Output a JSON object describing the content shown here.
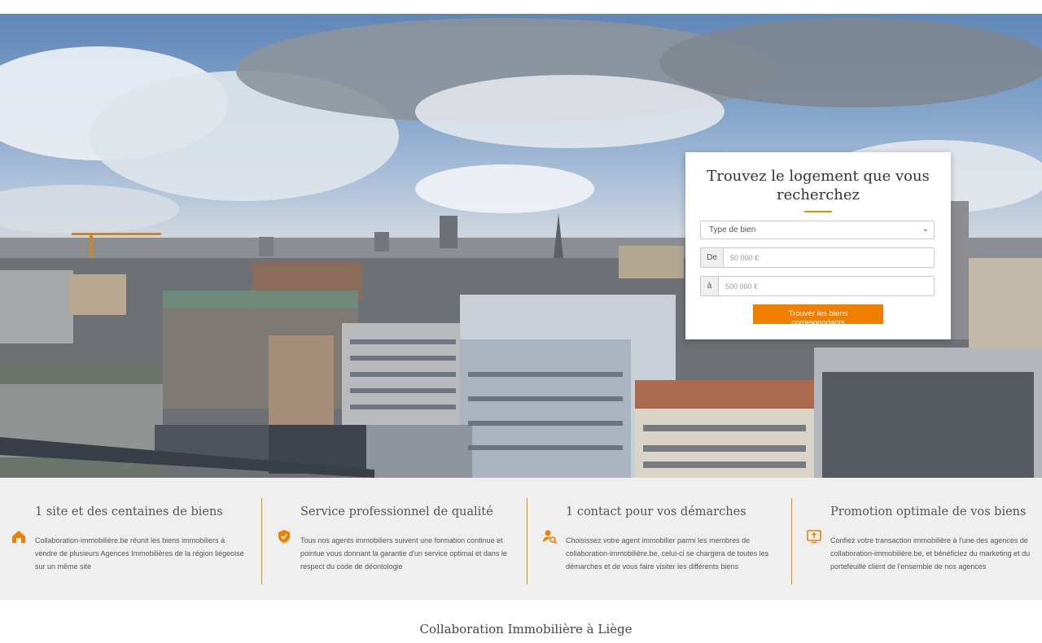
{
  "hero": {
    "image_alt": "Panorama de Liège"
  },
  "search": {
    "title": "Trouvez le logement que vous recherchez",
    "type_select_value": "Type de bien",
    "from_label": "De",
    "from_placeholder": "50 000 €",
    "to_label": "à",
    "to_placeholder": "500 000 €",
    "submit_label": "Trouver les biens correspondants"
  },
  "features": [
    {
      "icon": "house-icon",
      "title": "1 site et des centaines de biens",
      "text": "Collaboration-immobilière.be réunit les biens immobiliers à vendre de plusieurs Agences Immobilières de la région liégeoise sur un même site"
    },
    {
      "icon": "shield-check-icon",
      "title": "Service professionnel de qualité",
      "text": "Tous nos agents immobiliers suivent une formation continue et pointue vous donnant la garantie d'un service optimal et dans le respect du code de déontologie"
    },
    {
      "icon": "agent-search-icon",
      "title": "1 contact pour vos démarches",
      "text": "Choisissez votre agent immobilier parmi les membres de collaboration-immobilière.be, celui-ci se chargera de toutes les démarches et de vous faire visiter les différents biens"
    },
    {
      "icon": "promotion-screen-icon",
      "title": "Promotion optimale de vos biens",
      "text": "Confiez votre transaction immobilière à l'une des agences de collaboration-immobilière.be, et bénéficiez du marketing et du portefeuille client de l'ensemble de nos agences"
    }
  ],
  "section": {
    "title": "Collaboration Immobilière à Liège"
  },
  "colors": {
    "accent": "#f07f00",
    "features_bg": "#efefef"
  }
}
